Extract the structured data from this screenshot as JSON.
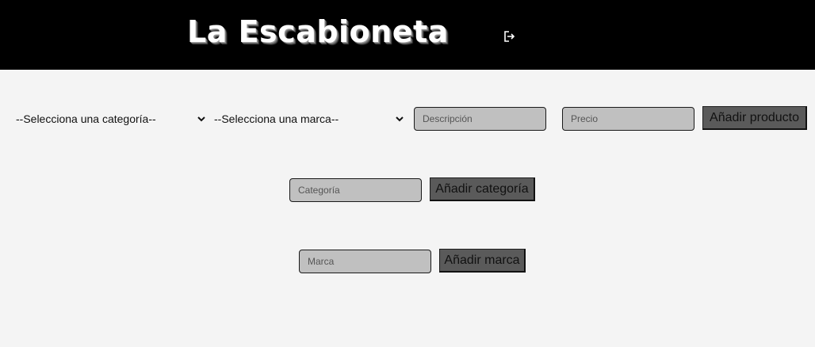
{
  "header": {
    "brand": "La Escabioneta",
    "logout_icon": "logout-icon"
  },
  "product_form": {
    "category_select": "--Selecciona una categoría--",
    "brand_select": "--Selecciona una marca--",
    "description_placeholder": "Descripción",
    "price_placeholder": "Precio",
    "submit_label": "Añadir producto"
  },
  "category_form": {
    "placeholder": "Categoría",
    "submit_label": "Añadir categoría"
  },
  "brand_form": {
    "placeholder": "Marca",
    "submit_label": "Añadir marca"
  },
  "colors": {
    "header_bg": "#000000",
    "page_bg": "#f4f4f4",
    "input_bg": "#c0c0c0",
    "button_bg": "#5a5a5a"
  }
}
